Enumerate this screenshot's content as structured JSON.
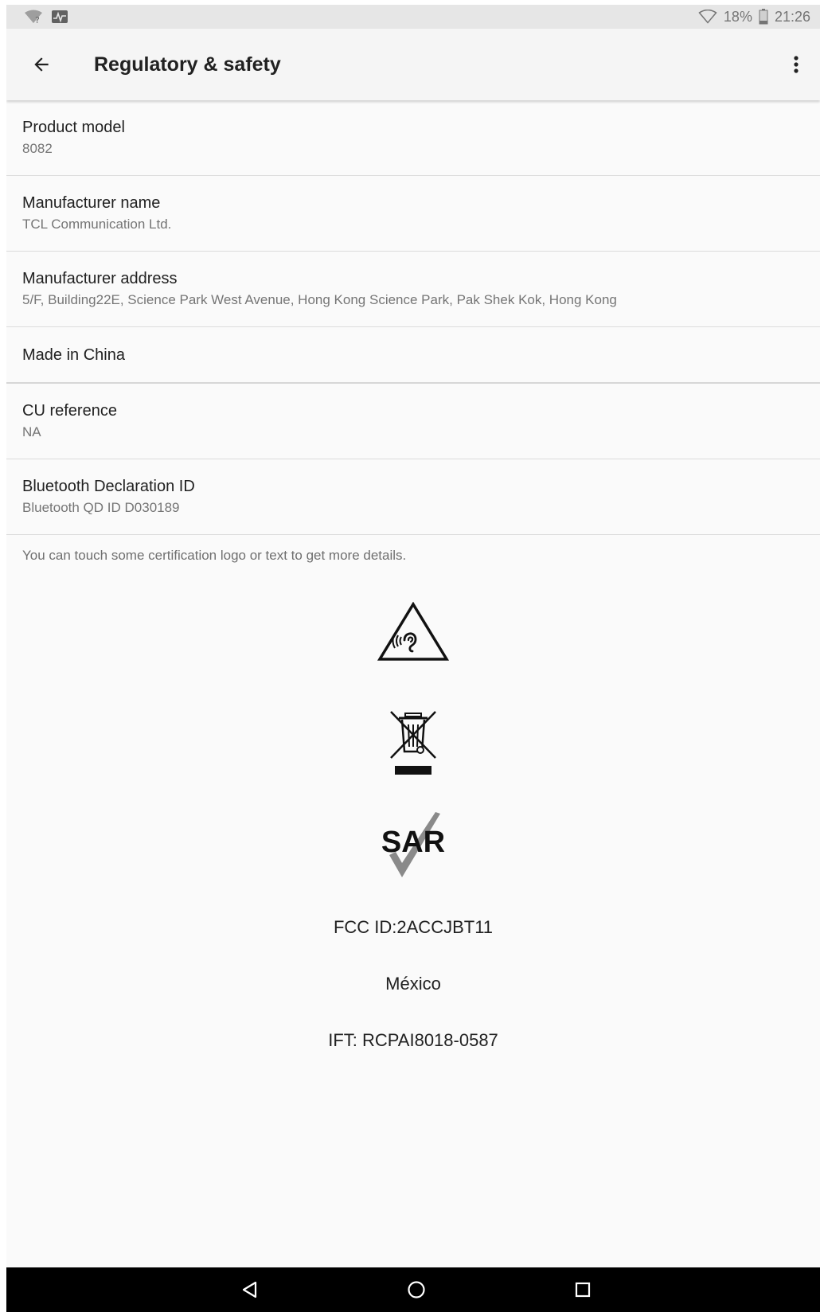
{
  "status_bar": {
    "battery": "18%",
    "time": "21:26",
    "icons": [
      "wifi-unknown-icon",
      "activity-notification-icon",
      "wifi-icon",
      "battery-icon"
    ]
  },
  "toolbar": {
    "title": "Regulatory & safety",
    "back_icon": "arrow-back-icon",
    "overflow_icon": "more-vert-icon"
  },
  "items": [
    {
      "title": "Product model",
      "summary": "8082"
    },
    {
      "title": "Manufacturer name",
      "summary": "TCL Communication Ltd."
    },
    {
      "title": "Manufacturer address",
      "summary": "5/F, Building22E, Science Park West Avenue, Hong Kong Science Park, Pak Shek Kok, Hong Kong"
    },
    {
      "title": "Made in China"
    },
    {
      "title": "CU reference",
      "summary": "NA"
    },
    {
      "title": "Bluetooth Declaration ID",
      "summary": "Bluetooth QD ID D030189"
    }
  ],
  "hint": "You can touch some certification logo or text to get more details.",
  "logos": {
    "hearing": "hearing-warning-icon",
    "weee": "weee-crossed-bin-icon",
    "sar_text": "SAR"
  },
  "certifications": {
    "fcc": "FCC ID:2ACCJBT11",
    "mexico": "México",
    "ift": "IFT: RCPAI8018-0587"
  },
  "nav_bar": {
    "icons": [
      "nav-back-icon",
      "nav-home-icon",
      "nav-recents-icon"
    ]
  }
}
